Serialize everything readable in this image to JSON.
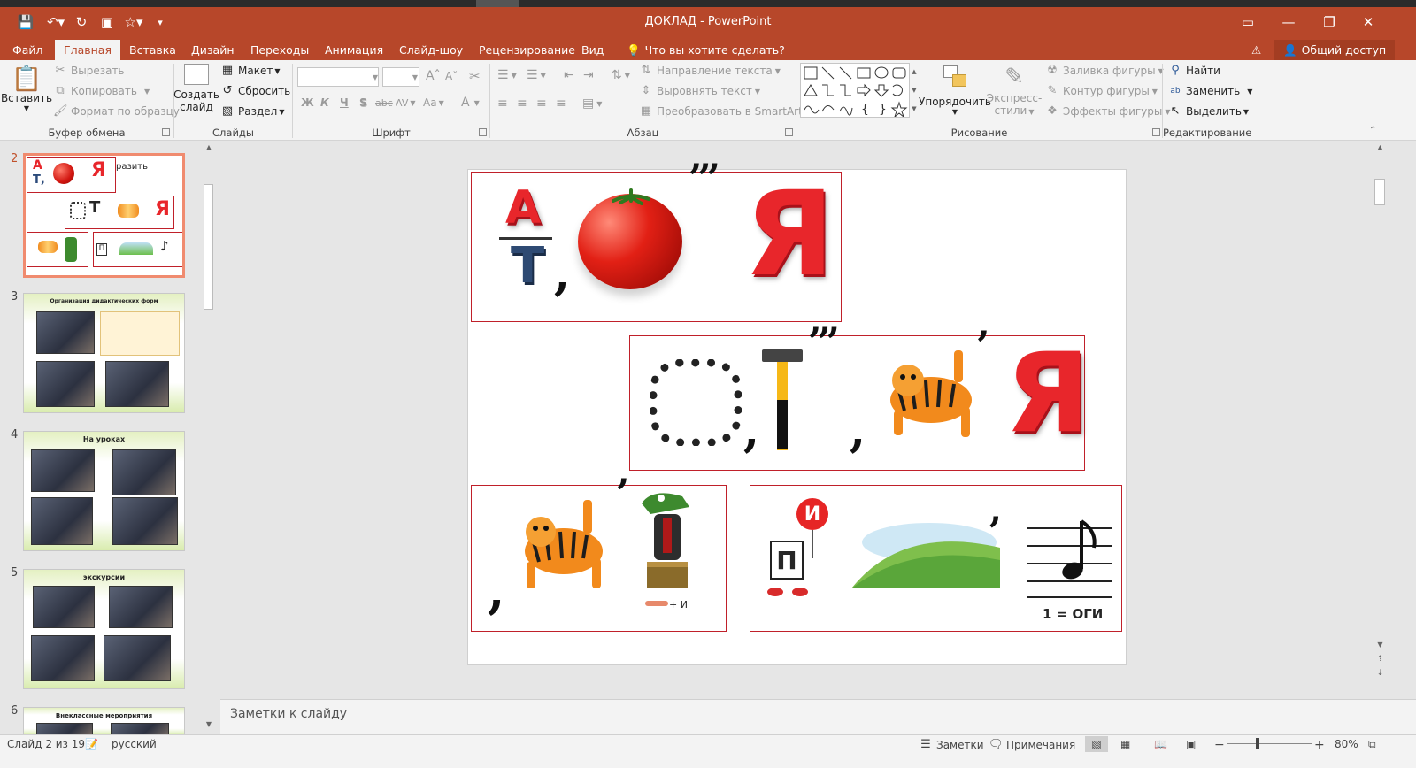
{
  "app": {
    "title": "ДОКЛАД - PowerPoint"
  },
  "tabs": [
    {
      "label": "Файл"
    },
    {
      "label": "Главная",
      "active": true
    },
    {
      "label": "Вставка"
    },
    {
      "label": "Дизайн"
    },
    {
      "label": "Переходы"
    },
    {
      "label": "Анимация"
    },
    {
      "label": "Слайд-шоу"
    },
    {
      "label": "Рецензирование"
    },
    {
      "label": "Вид"
    }
  ],
  "tell_me": "Что вы хотите сделать?",
  "share": "Общий доступ",
  "ribbon": {
    "clipboard": {
      "paste": "Вставить",
      "cut": "Вырезать",
      "copy": "Копировать",
      "format_painter": "Формат по образцу",
      "label": "Буфер обмена"
    },
    "slides": {
      "new_slide": "Создать",
      "new_slide_2": "слайд",
      "layout": "Макет",
      "reset": "Сбросить",
      "section": "Раздел",
      "label": "Слайды"
    },
    "font": {
      "bold": "Ж",
      "italic": "К",
      "underline": "Ч",
      "shadow": "S",
      "strike": "abc",
      "spacing": "AV",
      "case": "Aa",
      "color": "A",
      "label": "Шрифт"
    },
    "paragraph": {
      "text_direction": "Направление текста",
      "align_text": "Выровнять текст",
      "smartart": "Преобразовать в SmartArt",
      "label": "Абзац"
    },
    "drawing": {
      "arrange": "Упорядочить",
      "quick_styles": "Экспресс-",
      "quick_styles_2": "стили",
      "shape_fill": "Заливка фигуры",
      "shape_outline": "Контур фигуры",
      "shape_effects": "Эффекты фигуры",
      "label": "Рисование"
    },
    "editing": {
      "find": "Найти",
      "replace": "Заменить",
      "select": "Выделить",
      "label": "Редактирование"
    }
  },
  "thumbnails": [
    {
      "num": "2",
      "text": "разить"
    },
    {
      "num": "3",
      "title": "Организация дидактических форм"
    },
    {
      "num": "4",
      "title": "На уроках"
    },
    {
      "num": "5",
      "title": "экскурсии"
    },
    {
      "num": "6",
      "title": "Внеклассные мероприятия"
    }
  ],
  "slide": {
    "row1": {
      "top": "А",
      "bottom": "Т",
      "quote_marks": "ʼʼʼ",
      "letter": "Я"
    },
    "row2": {
      "quote_marks": "ʼʼʼ",
      "letter": "Я",
      "small_quote": "ʼ"
    },
    "row3": {
      "caption": "+ И"
    },
    "row4": {
      "balloon": "И",
      "card": "П",
      "equation": "1 = ОГИ"
    }
  },
  "notes_placeholder": "Заметки к слайду",
  "status": {
    "slide_info": "Слайд 2 из 19",
    "language": "русский",
    "notes": "Заметки",
    "comments": "Примечания",
    "zoom": "80%"
  }
}
